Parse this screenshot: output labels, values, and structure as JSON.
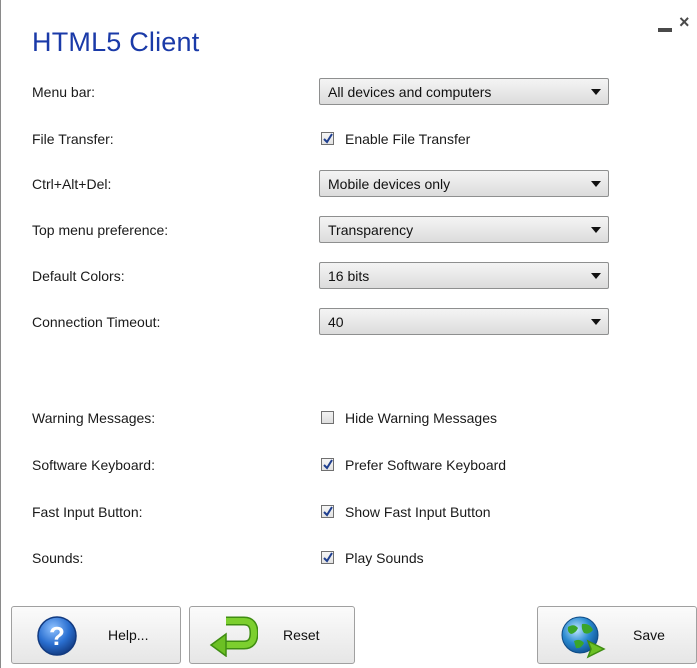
{
  "window": {
    "title": "HTML5 Client",
    "minimize_label": "",
    "close_label": "×"
  },
  "settings": {
    "menu_bar": {
      "label": "Menu bar:",
      "value": "All devices and computers"
    },
    "file_transfer": {
      "label": "File Transfer:",
      "checkbox_label": "Enable File Transfer",
      "checked": true
    },
    "ctrl_alt_del": {
      "label": "Ctrl+Alt+Del:",
      "value": "Mobile devices only"
    },
    "top_menu_preference": {
      "label": "Top menu preference:",
      "value": "Transparency"
    },
    "default_colors": {
      "label": "Default Colors:",
      "value": "16 bits"
    },
    "connection_timeout": {
      "label": "Connection Timeout:",
      "value": "40"
    },
    "warning_messages": {
      "label": "Warning Messages:",
      "checkbox_label": "Hide Warning Messages",
      "checked": false
    },
    "software_keyboard": {
      "label": "Software Keyboard:",
      "checkbox_label": "Prefer Software Keyboard",
      "checked": true
    },
    "fast_input_button": {
      "label": "Fast Input Button:",
      "checkbox_label": "Show Fast Input Button",
      "checked": true
    },
    "sounds": {
      "label": "Sounds:",
      "checkbox_label": "Play Sounds",
      "checked": true
    }
  },
  "buttons": {
    "help_label": "Help...",
    "reset_label": "Reset",
    "save_label": "Save"
  },
  "icons": {
    "help": "help-icon",
    "reset": "reset-arrow-icon",
    "save": "globe-save-icon"
  },
  "colors": {
    "title": "#1a3aa8",
    "help_icon": "#2a6fd0",
    "reset_icon": "#5fae1e",
    "save_icon": "#2a8ad0"
  }
}
